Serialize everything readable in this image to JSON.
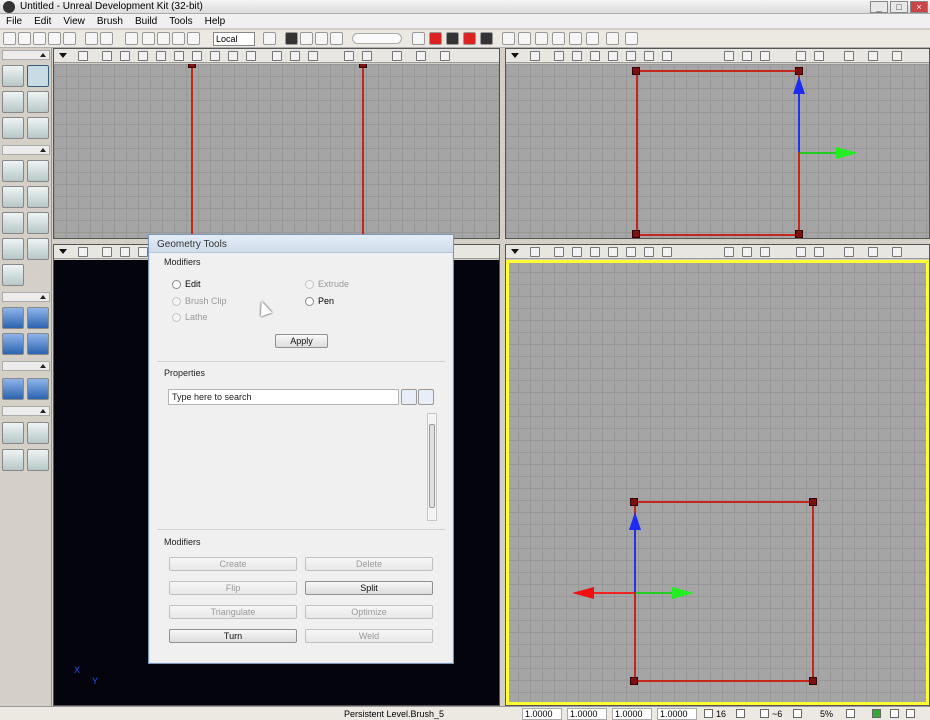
{
  "window": {
    "title": "Untitled - Unreal Development Kit (32-bit)"
  },
  "menu": [
    "File",
    "Edit",
    "View",
    "Brush",
    "Build",
    "Tools",
    "Help"
  ],
  "toolbar": {
    "coord_system": "Local"
  },
  "dialog": {
    "title": "Geometry Tools",
    "modifiers_label": "Modifiers",
    "modes": [
      {
        "label": "Edit",
        "enabled": true
      },
      {
        "label": "Extrude",
        "enabled": false
      },
      {
        "label": "Brush Clip",
        "enabled": false
      },
      {
        "label": "Pen",
        "enabled": true
      },
      {
        "label": "Lathe",
        "enabled": false
      }
    ],
    "apply_label": "Apply",
    "properties_label": "Properties",
    "search_placeholder": "Type here to search",
    "modifiers2_label": "Modifiers",
    "actions": [
      {
        "label": "Create",
        "enabled": false
      },
      {
        "label": "Delete",
        "enabled": false
      },
      {
        "label": "Flip",
        "enabled": false
      },
      {
        "label": "Split",
        "enabled": true
      },
      {
        "label": "Triangulate",
        "enabled": false
      },
      {
        "label": "Optimize",
        "enabled": false
      },
      {
        "label": "Turn",
        "enabled": true
      },
      {
        "label": "Weld",
        "enabled": false
      }
    ]
  },
  "viewport_axes": {
    "x": "X",
    "y": "Y"
  },
  "status": {
    "level": "Persistent Level.Brush_5",
    "scales": [
      "1.0000",
      "1.0000",
      "1.0000",
      "1.0000"
    ],
    "grid": "16",
    "rotation": "~6",
    "zoom": "5%"
  },
  "colors": {
    "brush": "#c4281c",
    "active_viewport": "#ffff33",
    "gizmo_z": "#1d2cf0",
    "gizmo_y": "#22ee22",
    "gizmo_x": "#ee1111"
  }
}
